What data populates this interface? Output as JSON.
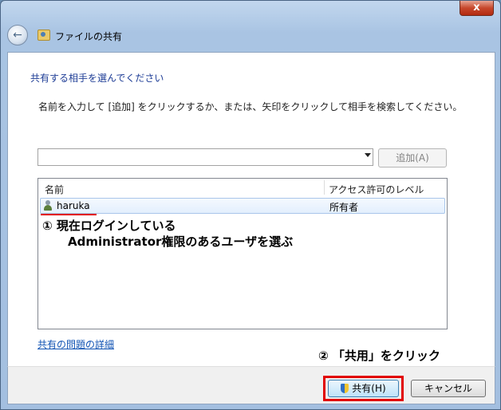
{
  "window": {
    "title": "ファイルの共有",
    "close_label": "x"
  },
  "main": {
    "heading": "共有する相手を選んでください",
    "instruction": "名前を入力して [追加] をクリックするか、または、矢印をクリックして相手を検索してください。",
    "user_combo": {
      "value": ""
    },
    "add_button_label": "追加(A)",
    "list": {
      "columns": [
        "名前",
        "アクセス許可のレベル"
      ],
      "rows": [
        {
          "name": "haruka",
          "access": "所有者"
        }
      ]
    },
    "details_link": "共有の問題の詳細"
  },
  "annotations": {
    "step1_line1": "① 現在ログインしている",
    "step1_line2": "Administrator権限のあるユーザを選ぶ",
    "step2": "② 「共用」をクリック"
  },
  "footer": {
    "share_button_label": "共有(H)",
    "cancel_button_label": "キャンセル"
  },
  "colors": {
    "heading": "#1e3d96",
    "link": "#0f52b3",
    "annotation_highlight": "#e10000"
  }
}
